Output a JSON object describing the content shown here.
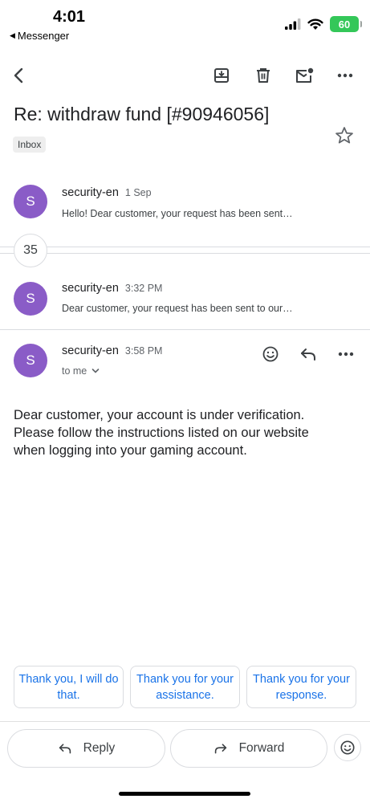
{
  "status_bar": {
    "time": "4:01",
    "back_app": "Messenger",
    "battery": "60"
  },
  "toolbar": {
    "icons": [
      "back-arrow-icon",
      "archive-icon",
      "trash-icon",
      "mark-unread-icon",
      "more-vert-icon"
    ]
  },
  "email": {
    "subject": "Re: withdraw fund [#90946056]",
    "label": "Inbox",
    "collapsed_count": "35"
  },
  "messages": [
    {
      "avatar": "S",
      "sender": "security-en",
      "date": "1 Sep",
      "snippet": "Hello! Dear customer, your request has been sent…"
    },
    {
      "avatar": "S",
      "sender": "security-en",
      "date": "3:32 PM",
      "snippet": "Dear customer, your request has been sent to our…"
    },
    {
      "avatar": "S",
      "sender": "security-en",
      "date": "3:58 PM",
      "recipient": "to me",
      "body": "Dear customer, your account is under verification. Please follow the instructions listed on our website when logging into your gaming account."
    }
  ],
  "smart_replies": [
    "Thank you, I will do that.",
    "Thank you for your assistance.",
    "Thank you for your response."
  ],
  "actions": {
    "reply": "Reply",
    "forward": "Forward"
  },
  "colors": {
    "avatar": "#8a5cc7",
    "link_blue": "#1a73e8",
    "battery_green": "#34c759"
  }
}
